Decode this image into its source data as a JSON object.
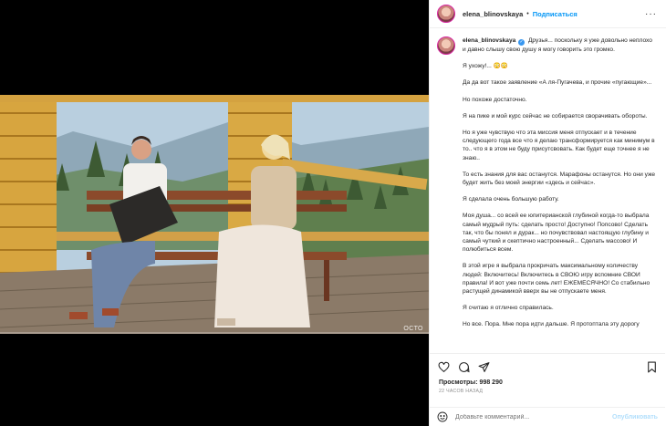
{
  "header": {
    "username": "elena_blinovskaya",
    "separator": "•",
    "follow_label": "Подписаться",
    "more_label": "···"
  },
  "media": {
    "watermark": "ОСТО"
  },
  "post": {
    "author": "elena_blinovskaya",
    "verified_mark": "✓",
    "paragraphs": [
      "Друзья... поскольку я уже довольно неплохо и давно слышу свою душу я могу говорить это громко.",
      "Я ухожу!... 😳😳",
      "Да да вот такое заявление «А ля-Пугачева, и прочие «пугающие»...",
      "Но похоже достаточно.",
      "Я на пике и мой курс сейчас не собирается сворачивать обороты.",
      "Но я уже чувствую что эта миссия меня отпускает и в течение следующего года все что я делаю трансформируется как минимум в то.. что я в этом не буду присутсвовать. Как будет еще точнее я не знаю..",
      "То есть знания для вас останутся. Марафоны останутся. Но они уже будет жить без моей энергии «здесь и сейчас».",
      "Я сделала очень большую работу.",
      "Моя душа... со всей ее юпитерианской глубиной когда-то выбрала самый мудрый путь: сделать просто! Доступно! Попсово! Сделать так, что бы понял и дурак... но почувствовал настоящую глубину и самый чуткий и скептично настроенный... Сделать массово! И полюбиться всем.",
      "В этой игре я выбрала прокричать максимальному количеству людей: Включитесь! Включитесь в СВОЮ игру вспомние СВОИ правила! И вот уже почти семь лет! ЕЖЕМЕСЯЧНО! Со стабильно растущей динамикой вверх вы не отпускаете меня.",
      "Я считаю я отлично справилась.",
      "Но все. Пора. Мне пора идти дальше. Я протоптала эту дорогу"
    ]
  },
  "footer": {
    "views_label": "Просмотры:",
    "views_count": "998 290",
    "time_ago": "22 часов назад",
    "comment_placeholder": "Добавьте комментарий...",
    "publish_label": "Опубликовать"
  },
  "icons": {
    "like": "heart-icon",
    "comment": "comment-bubble-icon",
    "share": "paper-plane-icon",
    "save": "bookmark-icon",
    "emoji": "smiley-icon",
    "more": "ellipsis-icon"
  },
  "colors": {
    "accent": "#0095f6",
    "verified": "#3897f0",
    "muted_text": "#8e8e8e",
    "publish_disabled": "#b2dffc"
  }
}
